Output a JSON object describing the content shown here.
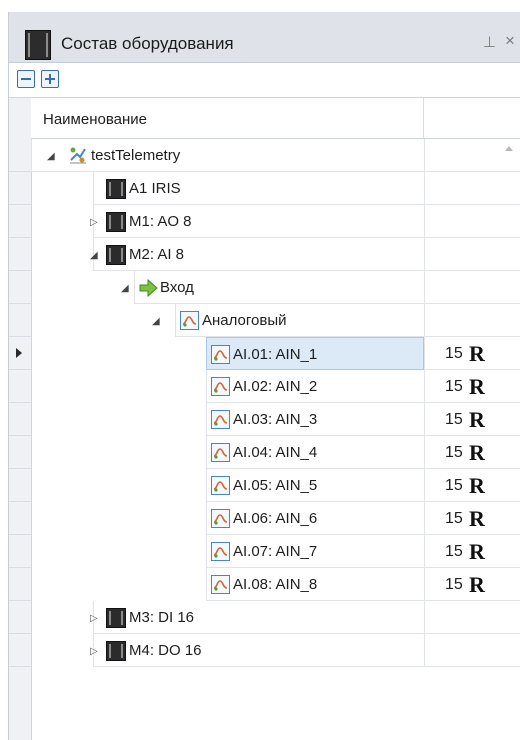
{
  "window": {
    "title": "Состав оборудования",
    "pin_icon": "pin-icon",
    "close_icon": "close-icon"
  },
  "toolbar": {
    "collapse_icon": "minus-box-icon",
    "expand_icon": "plus-box-icon"
  },
  "grid": {
    "column_header": "Наименование",
    "rows": [
      {
        "label": "testTelemetry",
        "icon": "telemetry-icon",
        "expander": "open"
      },
      {
        "label": "A1 IRIS",
        "icon": "device-icon"
      },
      {
        "label": "M1: AO 8",
        "icon": "device-icon",
        "expander": "closed"
      },
      {
        "label": "M2: AI 8",
        "icon": "device-icon",
        "expander": "open"
      },
      {
        "label": "Вход",
        "icon": "input-arrow-icon",
        "expander": "open"
      },
      {
        "label": "Аналоговый",
        "icon": "analog-icon",
        "expander": "open"
      },
      {
        "label": "AI.01: AIN_1",
        "icon": "analog-icon",
        "value": "15",
        "flag": "R",
        "selected": true
      },
      {
        "label": "AI.02: AIN_2",
        "icon": "analog-icon",
        "value": "15",
        "flag": "R"
      },
      {
        "label": "AI.03: AIN_3",
        "icon": "analog-icon",
        "value": "15",
        "flag": "R"
      },
      {
        "label": "AI.04: AIN_4",
        "icon": "analog-icon",
        "value": "15",
        "flag": "R"
      },
      {
        "label": "AI.05: AIN_5",
        "icon": "analog-icon",
        "value": "15",
        "flag": "R"
      },
      {
        "label": "AI.06: AIN_6",
        "icon": "analog-icon",
        "value": "15",
        "flag": "R"
      },
      {
        "label": "AI.07: AIN_7",
        "icon": "analog-icon",
        "value": "15",
        "flag": "R"
      },
      {
        "label": "AI.08: AIN_8",
        "icon": "analog-icon",
        "value": "15",
        "flag": "R"
      },
      {
        "label": "M3: DI 16",
        "icon": "device-icon",
        "expander": "closed"
      },
      {
        "label": "M4: DO 16",
        "icon": "device-icon",
        "expander": "closed"
      }
    ]
  },
  "colors": {
    "selection": "#dce9f7",
    "accent": "#3a6cae",
    "titlebar": "#dfe3e9"
  }
}
